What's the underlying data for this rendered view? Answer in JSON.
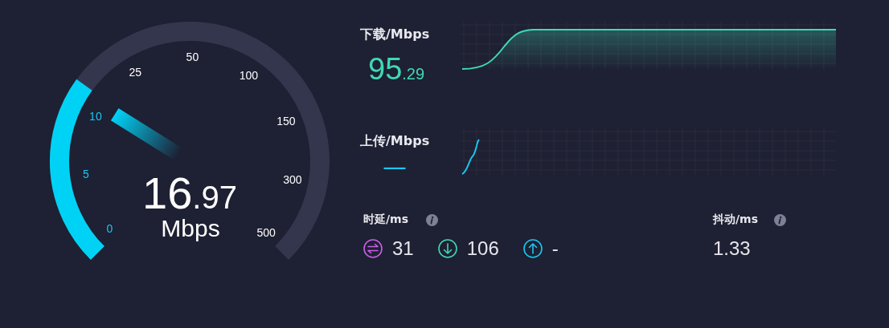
{
  "gauge": {
    "value_whole": "16",
    "value_fraction": ".97",
    "unit": "Mbps",
    "ticks": [
      {
        "label": "0",
        "reached": true
      },
      {
        "label": "5",
        "reached": true
      },
      {
        "label": "10",
        "reached": true
      },
      {
        "label": "25",
        "reached": false
      },
      {
        "label": "50",
        "reached": false
      },
      {
        "label": "100",
        "reached": false
      },
      {
        "label": "150",
        "reached": false
      },
      {
        "label": "300",
        "reached": false
      },
      {
        "label": "500",
        "reached": false
      }
    ]
  },
  "download": {
    "label": "下载/Mbps",
    "value_whole": "95",
    "value_fraction": ".29"
  },
  "upload": {
    "label": "上传/Mbps",
    "value": "—"
  },
  "latency": {
    "label": "时延/ms",
    "items": [
      {
        "kind": "ping",
        "value": "31"
      },
      {
        "kind": "download",
        "value": "106"
      },
      {
        "kind": "upload",
        "value": "-"
      }
    ]
  },
  "jitter": {
    "label": "抖动/ms",
    "value": "1.33"
  }
}
